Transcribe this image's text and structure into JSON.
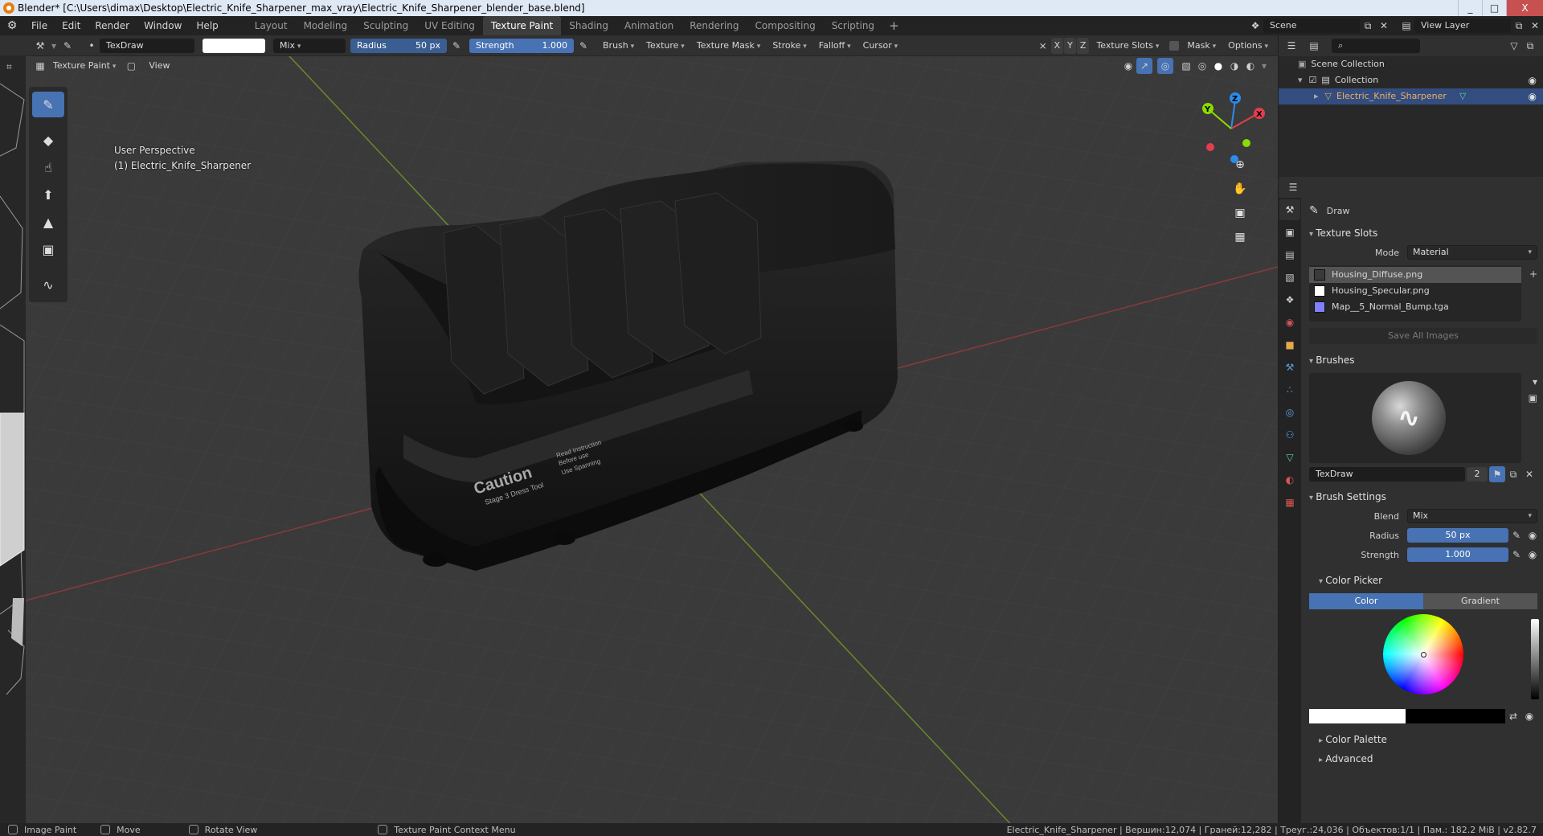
{
  "window": {
    "title": "Blender* [C:\\Users\\dimax\\Desktop\\Electric_Knife_Sharpener_max_vray\\Electric_Knife_Sharpener_blender_base.blend]",
    "controls": [
      "_",
      "□",
      "X"
    ]
  },
  "menu": {
    "items": [
      "File",
      "Edit",
      "Render",
      "Window",
      "Help"
    ]
  },
  "workspaces": {
    "tabs": [
      "Layout",
      "Modeling",
      "Sculpting",
      "UV Editing",
      "Texture Paint",
      "Shading",
      "Animation",
      "Rendering",
      "Compositing",
      "Scripting"
    ],
    "active": "Texture Paint",
    "add": "+"
  },
  "scene": {
    "name": "Scene",
    "view_layer": "View Layer"
  },
  "tool_header": {
    "brush_name": "TexDraw",
    "blend": "Mix",
    "radius_label": "Radius",
    "radius_value": "50 px",
    "strength_label": "Strength",
    "strength_value": "1.000",
    "menus": [
      "Brush",
      "Texture",
      "Texture Mask",
      "Stroke",
      "Falloff",
      "Cursor"
    ],
    "axes": [
      "X",
      "Y",
      "Z"
    ],
    "texture_slots": "Texture Slots",
    "mask": "Mask",
    "options": "Options"
  },
  "viewport_header": {
    "mode": "Texture Paint",
    "view": "View"
  },
  "viewport": {
    "perspective": "User Perspective",
    "object": "(1) Electric_Knife_Sharpener",
    "decal_title": "Caution",
    "decal_lines": [
      "Read Instruction",
      "Before use",
      "Use Spanning"
    ],
    "decal_sub": "Stage 3 Dress Tool",
    "gizmo": {
      "x": "X",
      "y": "Y",
      "z": "Z"
    }
  },
  "outliner": {
    "root": "Scene Collection",
    "collection": "Collection",
    "object": "Electric_Knife_Sharpener"
  },
  "properties": {
    "tool_name": "Draw",
    "texture_slots_title": "Texture Slots",
    "mode_label": "Mode",
    "mode_value": "Material",
    "slots": [
      {
        "name": "Housing_Diffuse.png",
        "color": "#3a3a3a"
      },
      {
        "name": "Housing_Specular.png",
        "color": "#ffffff"
      },
      {
        "name": "Map__5_Normal_Bump.tga",
        "color": "#8080ff"
      }
    ],
    "save_all": "Save All Images",
    "brushes_title": "Brushes",
    "brush_name": "TexDraw",
    "brush_users": "2",
    "brush_settings_title": "Brush Settings",
    "blend_label": "Blend",
    "blend_value": "Mix",
    "radius_label": "Radius",
    "radius_value": "50 px",
    "strength_label": "Strength",
    "strength_value": "1.000",
    "color_picker_title": "Color Picker",
    "color_tab": "Color",
    "gradient_tab": "Gradient",
    "color_palette_title": "Color Palette",
    "advanced_title": "Advanced"
  },
  "statusbar": {
    "items": [
      "Image Paint",
      "Move",
      "Rotate View",
      "Texture Paint Context Menu"
    ],
    "stats": "Electric_Knife_Sharpener | Вершин:12,074 | Граней:12,282 | Треуг.:24,036 | Объектов:1/1 | Пам.: 182.2 MiB | v2.82.7"
  },
  "colors": {
    "accent": "#4772b3",
    "selection": "#334d80",
    "x_axis": "#e53d4f",
    "y_axis": "#8bdc00",
    "z_axis": "#2d8ceb"
  }
}
